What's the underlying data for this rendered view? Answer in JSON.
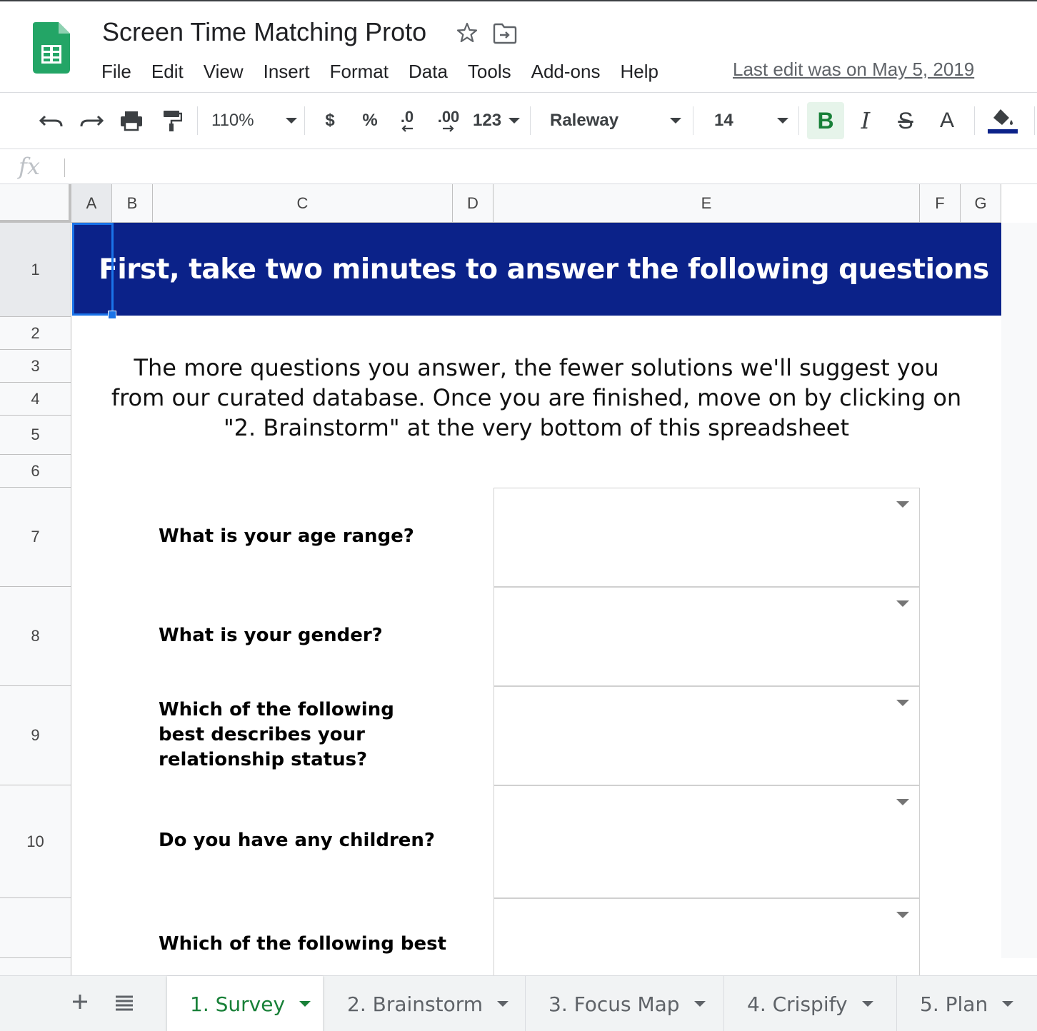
{
  "document": {
    "title": "Screen Time Matching Proto",
    "last_edit": "Last edit was on May 5, 2019"
  },
  "menu": [
    "File",
    "Edit",
    "View",
    "Insert",
    "Format",
    "Data",
    "Tools",
    "Add-ons",
    "Help"
  ],
  "toolbar": {
    "zoom": "110%",
    "currency": "$",
    "percent": "%",
    "decrease_decimal": ".0",
    "increase_decimal": ".00",
    "more_formats": "123",
    "font": "Raleway",
    "font_size": "14",
    "bold": "B",
    "italic": "I",
    "strikethrough": "S",
    "text_color": "A",
    "fill_color": "#0b2289",
    "bold_active": true
  },
  "formula_bar": {
    "label": "fx",
    "value": ""
  },
  "columns": [
    "A",
    "B",
    "C",
    "D",
    "E",
    "F",
    "G"
  ],
  "selected_cell": "A1",
  "rows": [
    "1",
    "2",
    "3",
    "4",
    "5",
    "6",
    "7",
    "8",
    "9",
    "10"
  ],
  "banner": {
    "text": "First, take two minutes to answer the following questions",
    "background": "#0b2289"
  },
  "intro": {
    "line1": "The more questions you answer, the fewer solutions we'll suggest you",
    "line2": "from our curated database. Once you are finished, move on by clicking on",
    "line3": "\"2. Brainstorm\" at the very bottom of this spreadsheet"
  },
  "questions": [
    {
      "label": "What is your age range?",
      "value": ""
    },
    {
      "label": "What is your gender?",
      "value": ""
    },
    {
      "label": "Which of the following best describes your relationship status?",
      "value": ""
    },
    {
      "label": "Do you have any children?",
      "value": ""
    },
    {
      "label": "Which of the following best",
      "value": ""
    }
  ],
  "sheets": [
    {
      "label": "1. Survey",
      "active": true
    },
    {
      "label": "2. Brainstorm",
      "active": false
    },
    {
      "label": "3. Focus Map",
      "active": false
    },
    {
      "label": "4. Crispify",
      "active": false
    },
    {
      "label": "5. Plan",
      "active": false
    }
  ],
  "colors": {
    "accent": "#188038",
    "selection": "#1a73e8"
  }
}
